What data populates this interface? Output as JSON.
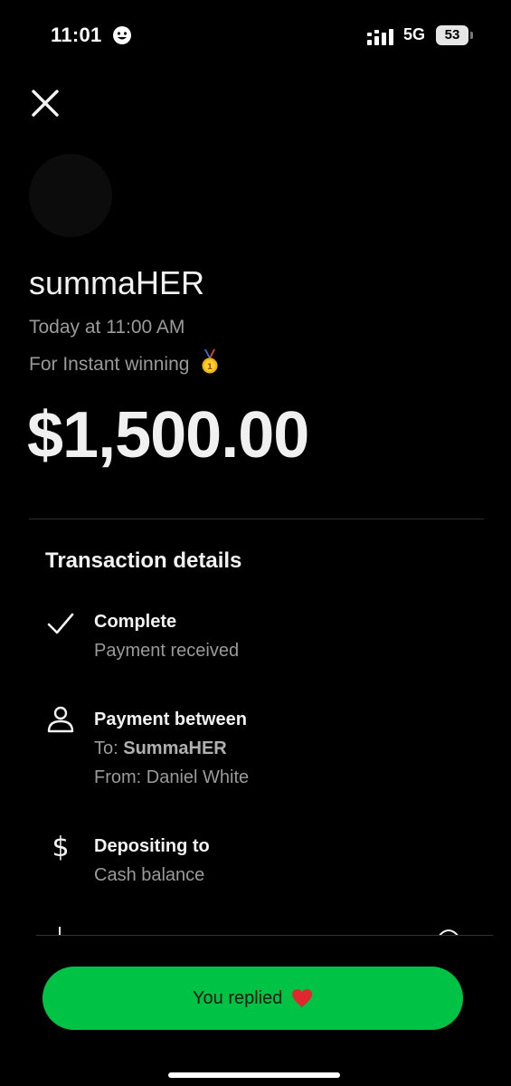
{
  "status_bar": {
    "time": "11:01",
    "network": "5G",
    "battery": "53"
  },
  "payment": {
    "name": "summaHER",
    "timestamp": "Today at 11:00 AM",
    "note": "For Instant winning",
    "amount": "$1,500.00"
  },
  "details": {
    "title": "Transaction details",
    "status": {
      "title": "Complete",
      "subtitle": "Payment received"
    },
    "between": {
      "title": "Payment between",
      "to_label": "To:",
      "to_value": "SummaHER",
      "from_label": "From:",
      "from_value": "Daniel White"
    },
    "deposit": {
      "title": "Depositing to",
      "subtitle": "Cash balance"
    }
  },
  "reply_button": {
    "label": "You replied"
  },
  "icons": {
    "close": "close-icon",
    "check": "check-icon",
    "person": "person-icon",
    "dollar": "dollar-icon",
    "medal": "medal-icon",
    "heart": "heart-icon"
  },
  "colors": {
    "background": "#000000",
    "accent_green": "#00c244",
    "secondary_text": "#9a9a9a"
  }
}
